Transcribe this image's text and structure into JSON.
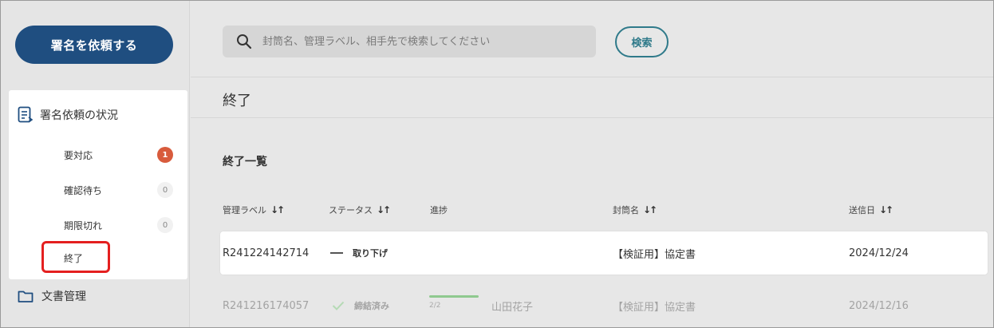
{
  "sidebar": {
    "request_button": "署名を依頼する",
    "status_section": {
      "title": "署名依頼の状況",
      "items": [
        {
          "label": "要対応",
          "count": "1"
        },
        {
          "label": "確認待ち",
          "count": "0"
        },
        {
          "label": "期限切れ",
          "count": "0"
        },
        {
          "label": "終了",
          "count": ""
        }
      ]
    },
    "docs_label": "文書管理"
  },
  "search": {
    "placeholder": "封筒名、管理ラベル、相手先で検索してください",
    "value": "",
    "button_label": "検索"
  },
  "main": {
    "page_title": "終了",
    "section_title": "終了一覧",
    "columns": [
      "管理ラベル",
      "ステータス",
      "進捗",
      "封筒名",
      "送信日"
    ],
    "rows": [
      {
        "label": "R241224142714",
        "status": "取り下げ",
        "progress": "",
        "recipient": "",
        "envelope": "【検証用】協定書",
        "date": "2024/12/24"
      },
      {
        "label": "R241216174057",
        "status": "締結済み",
        "progress": "2/2",
        "recipient": "山田花子",
        "envelope": "【検証用】協定書",
        "date": "2024/12/16"
      }
    ]
  },
  "colors": {
    "primary": "#1f4e80",
    "accent_teal": "#2f7a8a",
    "alert_badge": "#d85b3c",
    "highlight": "#e41f1f",
    "progress": "#8fc98f"
  },
  "icons": {
    "status_section": "document-list-icon",
    "docs": "folder-icon",
    "search": "search-icon",
    "sort": "sort-icon",
    "withdrawn": "dash-icon",
    "completed": "check-icon"
  }
}
